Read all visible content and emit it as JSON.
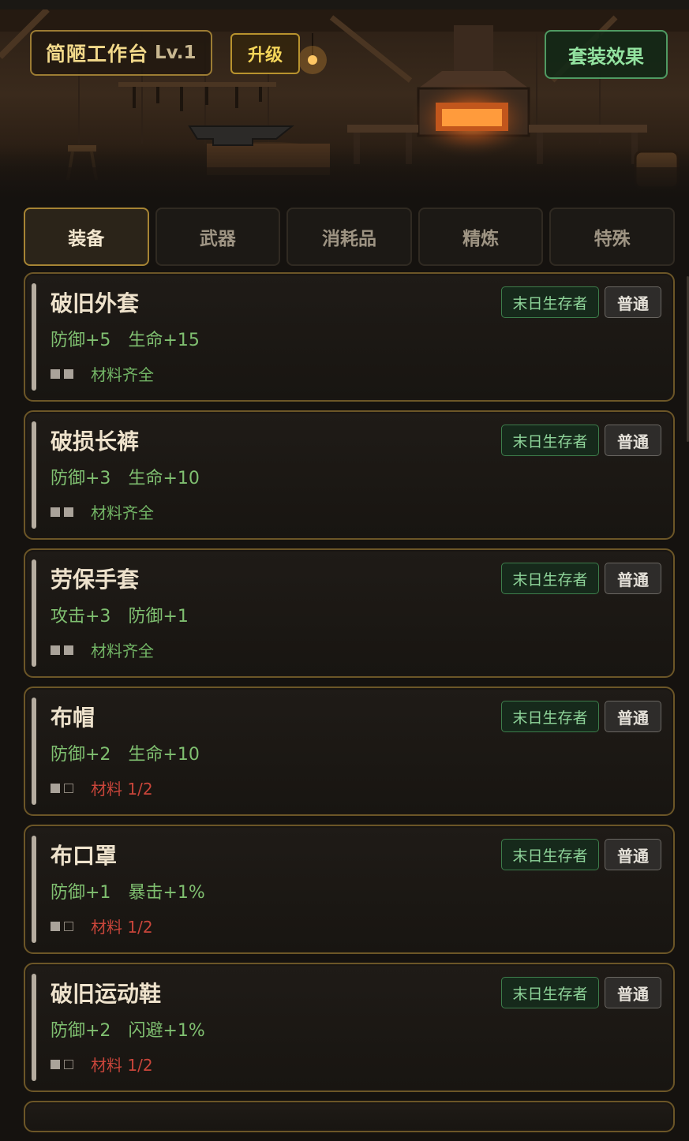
{
  "header": {
    "station_name": "简陋工作台",
    "station_level": "Lv.1",
    "upgrade_label": "升级",
    "set_effect_label": "套装效果"
  },
  "tabs": [
    {
      "label": "装备",
      "active": true
    },
    {
      "label": "武器",
      "active": false
    },
    {
      "label": "消耗品",
      "active": false
    },
    {
      "label": "精炼",
      "active": false
    },
    {
      "label": "特殊",
      "active": false
    }
  ],
  "items": [
    {
      "name": "破旧外套",
      "stats": [
        "防御+5",
        "生命+15"
      ],
      "set": "末日生存者",
      "rarity": "普通",
      "materials_have": 2,
      "materials_need": 2,
      "materials_text": "材料齐全"
    },
    {
      "name": "破损长裤",
      "stats": [
        "防御+3",
        "生命+10"
      ],
      "set": "末日生存者",
      "rarity": "普通",
      "materials_have": 2,
      "materials_need": 2,
      "materials_text": "材料齐全"
    },
    {
      "name": "劳保手套",
      "stats": [
        "攻击+3",
        "防御+1"
      ],
      "set": "末日生存者",
      "rarity": "普通",
      "materials_have": 2,
      "materials_need": 2,
      "materials_text": "材料齐全"
    },
    {
      "name": "布帽",
      "stats": [
        "防御+2",
        "生命+10"
      ],
      "set": "末日生存者",
      "rarity": "普通",
      "materials_have": 1,
      "materials_need": 2,
      "materials_text": "材料 1/2"
    },
    {
      "name": "布口罩",
      "stats": [
        "防御+1",
        "暴击+1%"
      ],
      "set": "末日生存者",
      "rarity": "普通",
      "materials_have": 1,
      "materials_need": 2,
      "materials_text": "材料 1/2"
    },
    {
      "name": "破旧运动鞋",
      "stats": [
        "防御+2",
        "闪避+1%"
      ],
      "set": "末日生存者",
      "rarity": "普通",
      "materials_have": 1,
      "materials_need": 2,
      "materials_text": "材料 1/2"
    }
  ],
  "colors": {
    "accent_gold": "#a68434",
    "stat_green": "#7fbf70",
    "ready_green": "#72b465",
    "missing_red": "#c9453a"
  }
}
